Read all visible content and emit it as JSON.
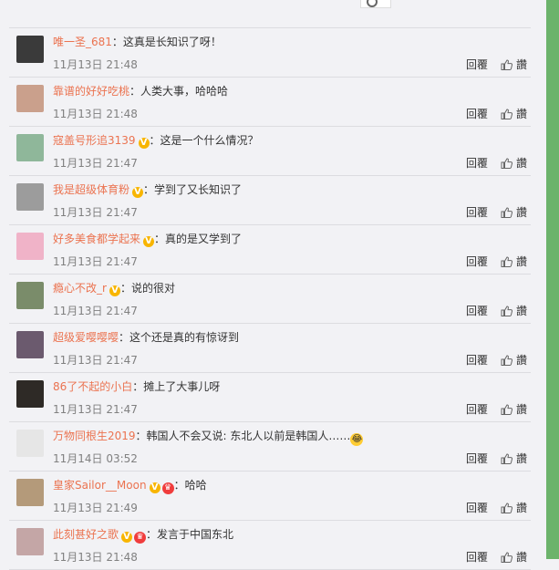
{
  "actions": {
    "reply_label": "回覆",
    "like_label": "讚"
  },
  "comments": [
    {
      "user": "唯一圣_681",
      "verified": false,
      "crown": false,
      "text": "：这真是长知识了呀！",
      "emoji": "",
      "time": "11月13日 21:48",
      "avatar_color": "#3a3a3a"
    },
    {
      "user": "靠谱的好好吃桃",
      "verified": false,
      "crown": false,
      "text": "：人类大事，哈哈哈",
      "emoji": "",
      "time": "11月13日 21:48",
      "avatar_color": "#caa08c"
    },
    {
      "user": "寇盖号形追3139",
      "verified": true,
      "crown": false,
      "text": "：这是一个什么情况？",
      "emoji": "",
      "time": "11月13日 21:47",
      "avatar_color": "#8fb79a"
    },
    {
      "user": "我是超级体育粉",
      "verified": true,
      "crown": false,
      "text": "：学到了又长知识了",
      "emoji": "",
      "time": "11月13日 21:47",
      "avatar_color": "#9c9c9c"
    },
    {
      "user": "好多美食都学起来",
      "verified": true,
      "crown": false,
      "text": "：真的是又学到了",
      "emoji": "",
      "time": "11月13日 21:47",
      "avatar_color": "#f0b3c8"
    },
    {
      "user": "瘾心不改_r",
      "verified": true,
      "crown": false,
      "text": "：说的很对",
      "emoji": "",
      "time": "11月13日 21:47",
      "avatar_color": "#7a8c6a"
    },
    {
      "user": "超级爱嘤嘤嘤",
      "verified": false,
      "crown": false,
      "text": "：这个还是真的有惊讶到",
      "emoji": "",
      "time": "11月13日 21:47",
      "avatar_color": "#6b5a6e"
    },
    {
      "user": "86了不起的小白",
      "verified": false,
      "crown": false,
      "text": "：摊上了大事儿呀",
      "emoji": "",
      "time": "11月13日 21:47",
      "avatar_color": "#2e2a26"
    },
    {
      "user": "万物同根生2019",
      "verified": false,
      "crown": false,
      "text": "：韩国人不会又说: 东北人以前是韩国人……",
      "emoji": "😂",
      "time": "11月14日 03:52",
      "avatar_color": "#e6e6e6"
    },
    {
      "user": "皇家Sailor__Moon",
      "verified": true,
      "crown": true,
      "text": "：哈哈",
      "emoji": "",
      "time": "11月13日 21:49",
      "avatar_color": "#b49a7a"
    },
    {
      "user": "此刻甚好之歌",
      "verified": true,
      "crown": true,
      "text": "：发言于中国东北",
      "emoji": "",
      "time": "11月13日 21:48",
      "avatar_color": "#c4a6a6"
    }
  ]
}
